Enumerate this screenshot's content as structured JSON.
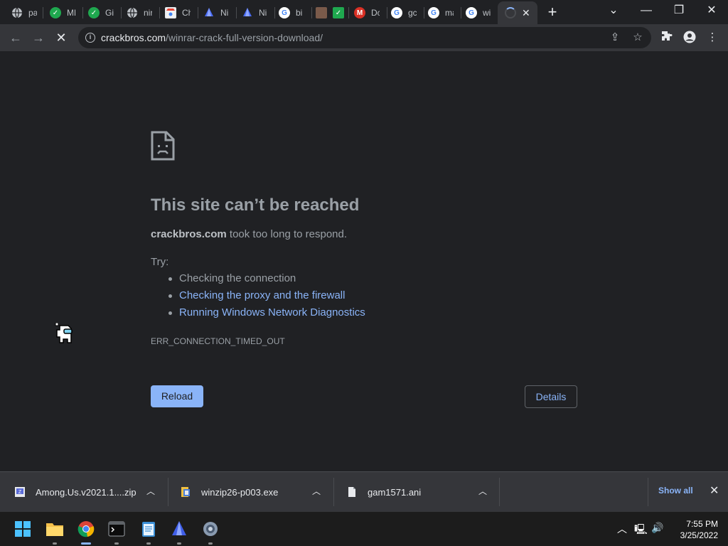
{
  "tabs": [
    {
      "title": "pa",
      "icon": "globe-icon"
    },
    {
      "title": "ME",
      "icon": "green-check-icon"
    },
    {
      "title": "Git",
      "icon": "green-check-icon"
    },
    {
      "title": "nir",
      "icon": "globe-icon"
    },
    {
      "title": "Ch",
      "icon": "chrome-store-icon"
    },
    {
      "title": "Ni",
      "icon": "blue-drop-icon"
    },
    {
      "title": "Ni",
      "icon": "blue-drop-icon"
    },
    {
      "title": "bi",
      "icon": "google-icon"
    },
    {
      "title": "",
      "icon": "avatar-icon"
    },
    {
      "title": "",
      "icon": "green-check-icon"
    },
    {
      "title": "Dc",
      "icon": "red-m-icon"
    },
    {
      "title": "gc",
      "icon": "google-icon"
    },
    {
      "title": "ma",
      "icon": "google-icon"
    },
    {
      "title": "wi",
      "icon": "google-icon"
    }
  ],
  "active_tab": {
    "title": "",
    "loading": true
  },
  "address_bar": {
    "host": "crackbros.com",
    "path": "/winrar-crack-full-version-download/"
  },
  "error_page": {
    "title": "This site can’t be reached",
    "host": "crackbros.com",
    "description": " took too long to respond.",
    "try_label": "Try:",
    "suggestions": [
      {
        "text": "Checking the connection",
        "link": false
      },
      {
        "text": "Checking the proxy and the firewall",
        "link": true
      },
      {
        "text": "Running Windows Network Diagnostics",
        "link": true
      }
    ],
    "error_code": "ERR_CONNECTION_TIMED_OUT",
    "reload_label": "Reload",
    "details_label": "Details"
  },
  "downloads": {
    "items": [
      {
        "name": "Among.Us.v2021.1....zip",
        "icon": "zip-archive-icon"
      },
      {
        "name": "winzip26-p003.exe",
        "icon": "installer-icon"
      },
      {
        "name": "gam1571.ani",
        "icon": "file-icon"
      }
    ],
    "show_all_label": "Show all"
  },
  "taskbar": {
    "apps": [
      "start-icon",
      "file-explorer-icon",
      "chrome-icon",
      "terminal-icon",
      "notepad-icon",
      "blue-drop-icon",
      "settings-icon"
    ],
    "time": "7:55 PM",
    "date": "3/25/2022"
  },
  "colors": {
    "background": "#202124",
    "toolbar": "#35363a",
    "accent": "#8ab4f8",
    "text_muted": "#9aa0a6"
  }
}
